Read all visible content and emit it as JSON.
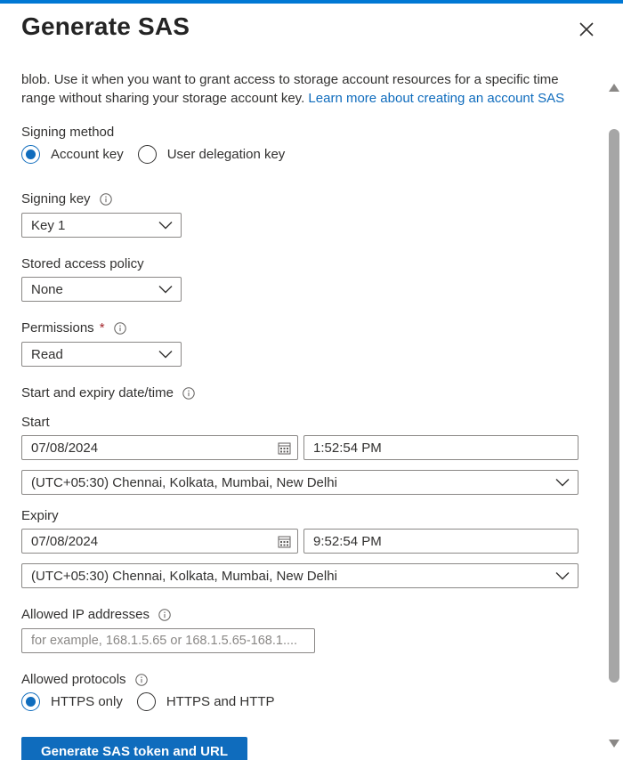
{
  "panel": {
    "title": "Generate SAS"
  },
  "intro": {
    "text": "blob. Use it when you want to grant access to storage account resources for a specific time range without sharing your storage account key.",
    "link": "Learn more about creating an account SAS"
  },
  "signing_method": {
    "label": "Signing method",
    "options": [
      "Account key",
      "User delegation key"
    ],
    "selected": "Account key"
  },
  "signing_key": {
    "label": "Signing key",
    "value": "Key 1"
  },
  "stored_access_policy": {
    "label": "Stored access policy",
    "value": "None"
  },
  "permissions": {
    "label": "Permissions",
    "required_marker": "*",
    "value": "Read"
  },
  "datetime_section": {
    "label": "Start and expiry date/time"
  },
  "start": {
    "label": "Start",
    "date": "07/08/2024",
    "time": "1:52:54 PM",
    "timezone": "(UTC+05:30) Chennai, Kolkata, Mumbai, New Delhi"
  },
  "expiry": {
    "label": "Expiry",
    "date": "07/08/2024",
    "time": "9:52:54 PM",
    "timezone": "(UTC+05:30) Chennai, Kolkata, Mumbai, New Delhi"
  },
  "allowed_ips": {
    "label": "Allowed IP addresses",
    "placeholder": "for example, 168.1.5.65 or 168.1.5.65-168.1...."
  },
  "allowed_protocols": {
    "label": "Allowed protocols",
    "options": [
      "HTTPS only",
      "HTTPS and HTTP"
    ],
    "selected": "HTTPS only"
  },
  "actions": {
    "generate_label": "Generate SAS token and URL"
  },
  "colors": {
    "accent": "#0f6cbd",
    "top_bar": "#0078d4",
    "required": "#a4262c"
  },
  "icons": [
    "close-icon",
    "info-icon",
    "chevron-down-icon",
    "calendar-icon",
    "scroll-up-arrow",
    "scroll-down-arrow"
  ]
}
